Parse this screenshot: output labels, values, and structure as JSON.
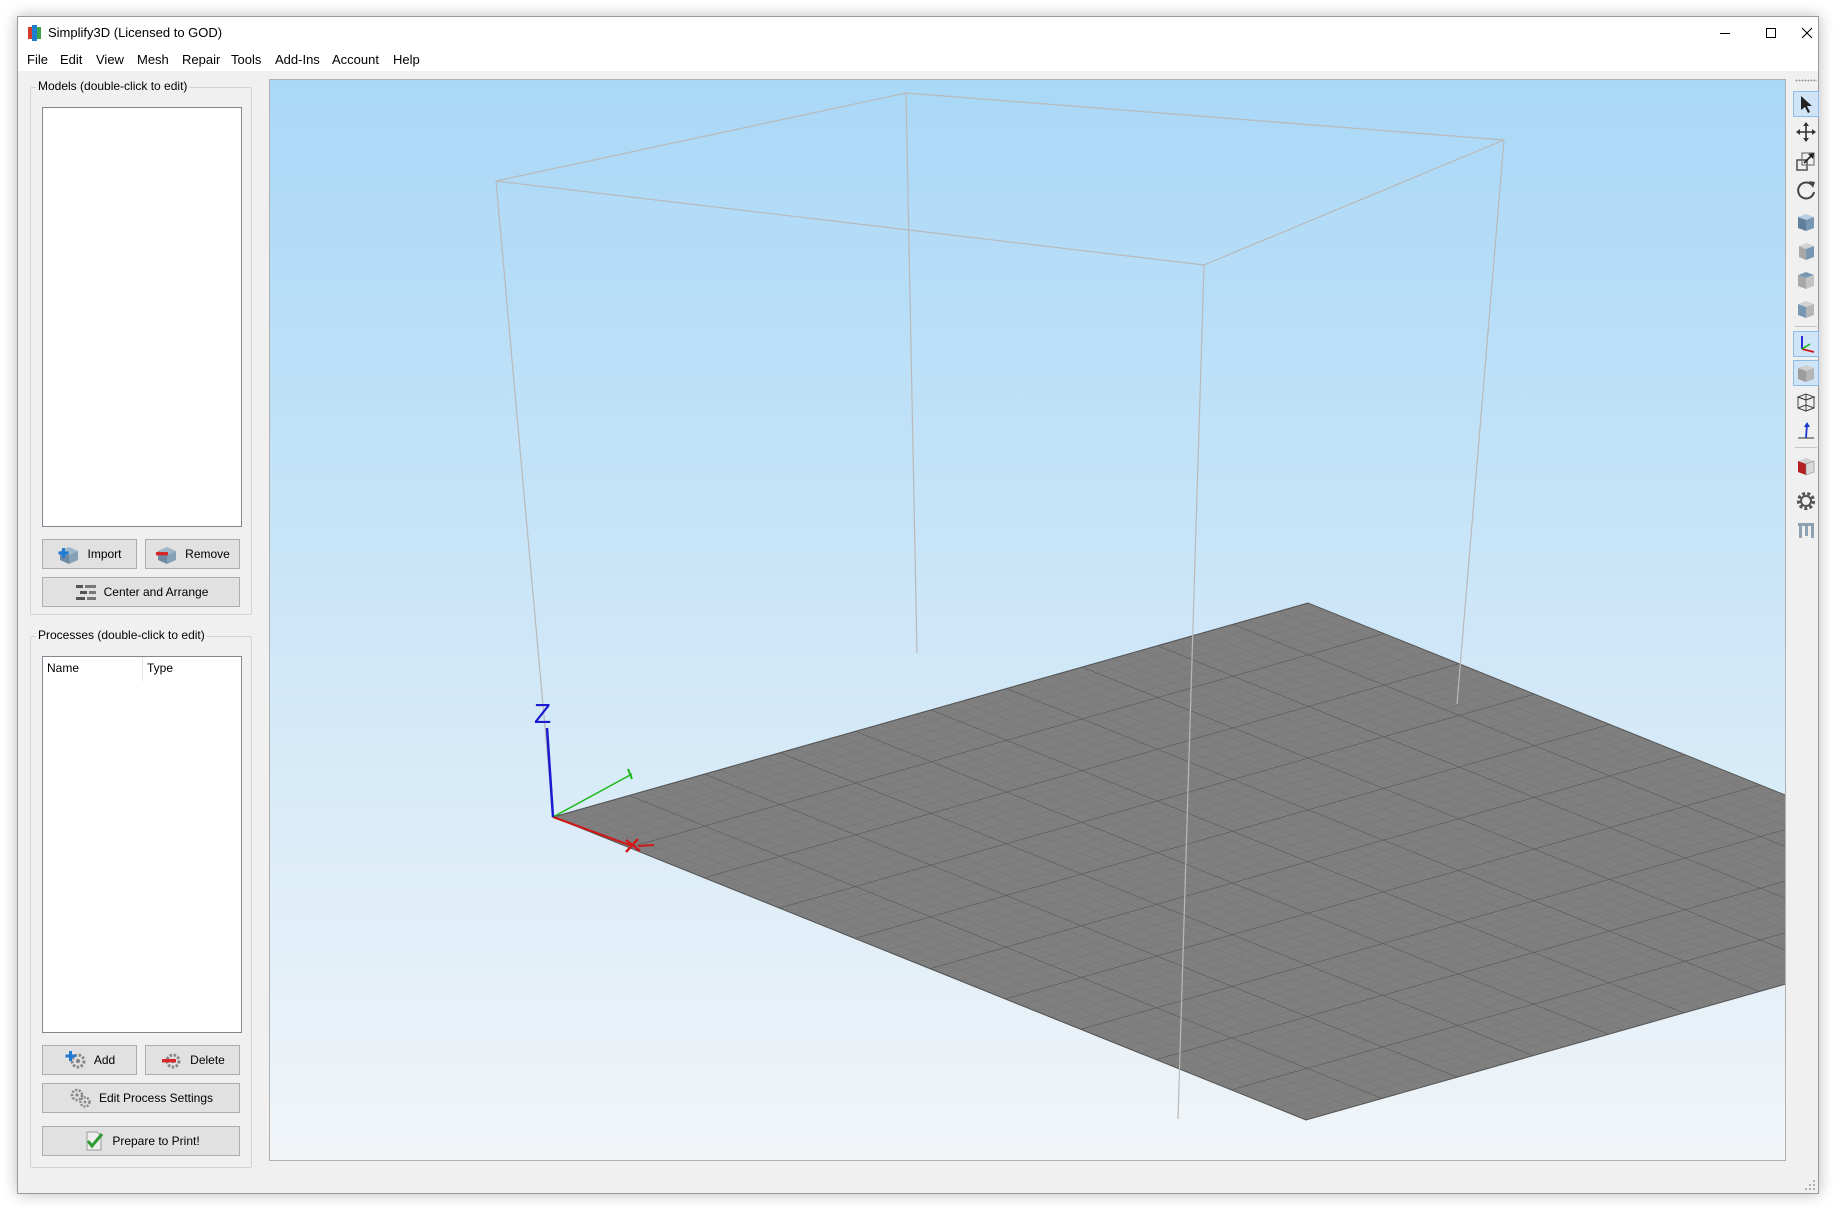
{
  "window": {
    "title": "Simplify3D (Licensed to GOD)"
  },
  "menu": {
    "items": [
      "File",
      "Edit",
      "View",
      "Mesh",
      "Repair",
      "Tools",
      "Add-Ins",
      "Account",
      "Help"
    ]
  },
  "models_panel": {
    "title": "Models (double-click to edit)",
    "import_label": "Import",
    "remove_label": "Remove",
    "center_arrange_label": "Center and Arrange"
  },
  "processes_panel": {
    "title": "Processes (double-click to edit)",
    "columns": [
      "Name",
      "Type"
    ],
    "add_label": "Add",
    "delete_label": "Delete",
    "edit_settings_label": "Edit Process Settings",
    "prepare_label": "Prepare to Print!"
  },
  "viewport": {
    "z_axis_label": "Z",
    "colors": {
      "sky_top": "#a9d8f7",
      "sky_bottom": "#f1f5f8",
      "bed": "#7f7f7f",
      "axis_x": "#d01818",
      "axis_y": "#18b818",
      "axis_z": "#1a1ad0"
    }
  },
  "toolbar": {
    "icons": [
      "select-icon",
      "move-icon",
      "scale-icon",
      "rotate-icon",
      "view-iso-cube-icon",
      "view-front-cube-icon",
      "view-top-cube-icon",
      "view-side-cube-icon",
      "axes-icon",
      "solid-cube-icon",
      "wireframe-cube-icon",
      "normals-icon",
      "cross-section-icon",
      "gear-icon",
      "supports-icon"
    ]
  }
}
